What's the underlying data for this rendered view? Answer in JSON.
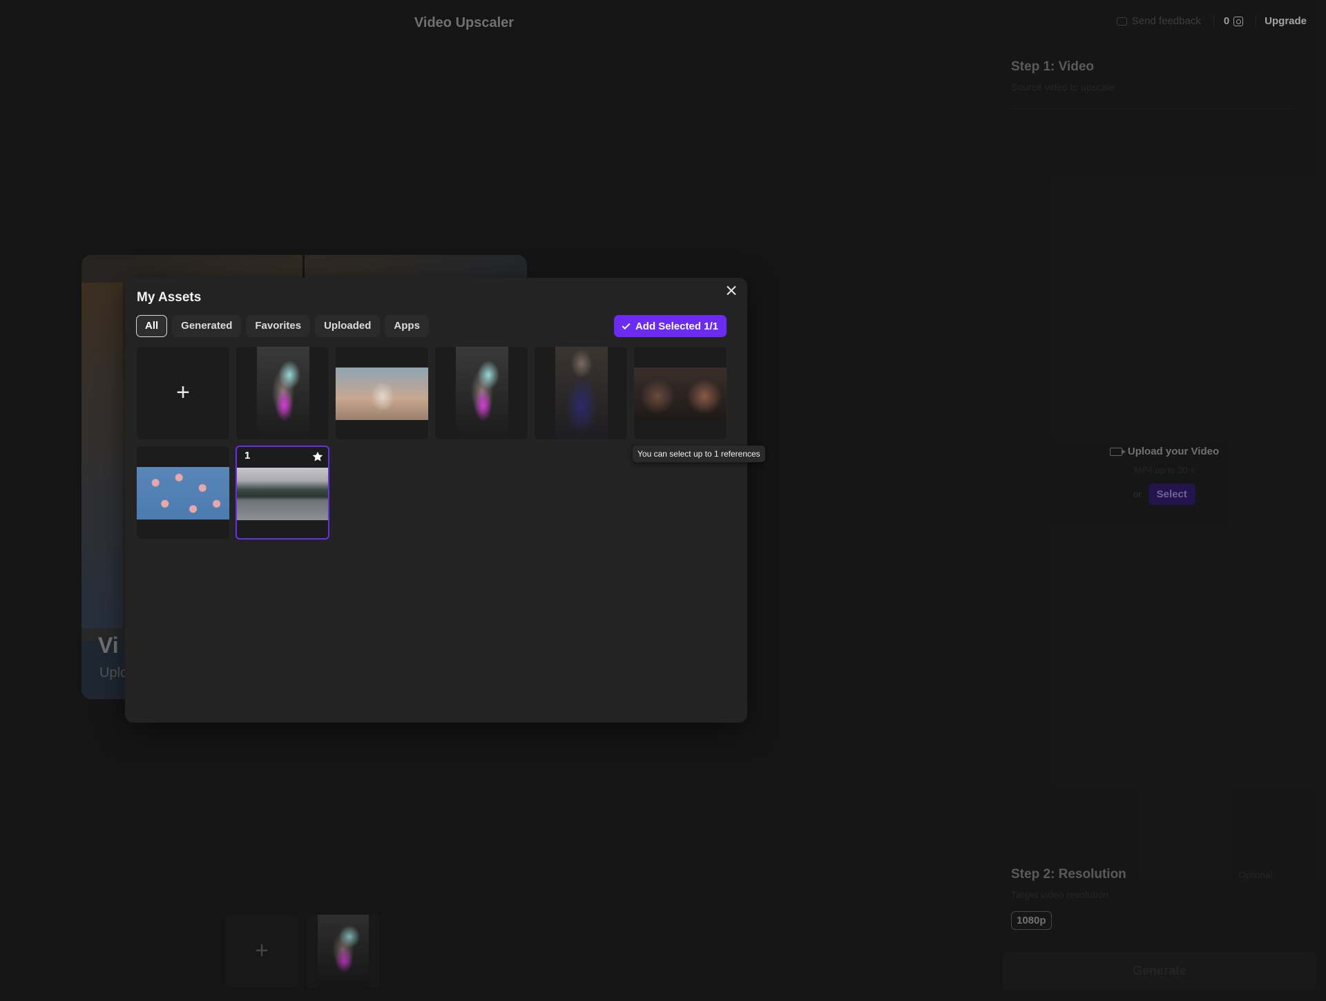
{
  "app": {
    "title": "Video Upscaler"
  },
  "topbar": {
    "feedback_label": "Send feedback",
    "credits": "0",
    "upgrade_label": "Upgrade"
  },
  "step1": {
    "title": "Step 1: Video",
    "subtitle": "Source video to upscale",
    "upload_label": "Upload your Video",
    "upload_hint": "MP4 up to 30 s",
    "or_text": "or",
    "select_label": "Select"
  },
  "step2": {
    "title": "Step 2: Resolution",
    "subtitle": "Target video resolution",
    "optional_label": "Optional",
    "resolution": "1080p"
  },
  "generate_label": "Generate",
  "bg_card": {
    "title": "Vi",
    "subtitle": "Uplc"
  },
  "ref_strip": {
    "add_symbol": "+"
  },
  "modal": {
    "title": "My Assets",
    "tabs": [
      {
        "label": "All",
        "active": true
      },
      {
        "label": "Generated",
        "active": false
      },
      {
        "label": "Favorites",
        "active": false
      },
      {
        "label": "Uploaded",
        "active": false
      },
      {
        "label": "Apps",
        "active": false
      }
    ],
    "add_selected_label": "Add Selected 1/1",
    "add_tile_symbol": "+",
    "tooltip": "You can select up to 1 references",
    "selected_number": "1",
    "assets": [
      {
        "name": "portrait-glow-1",
        "kind": "portrait-glow"
      },
      {
        "name": "sky-woman",
        "kind": "sky-woman"
      },
      {
        "name": "portrait-glow-2",
        "kind": "portrait-glow"
      },
      {
        "name": "necklace-woman",
        "kind": "necklace-woman"
      },
      {
        "name": "faces",
        "kind": "faces"
      },
      {
        "name": "blossom",
        "kind": "blossom"
      },
      {
        "name": "lake",
        "kind": "lake",
        "selected": true,
        "favorite": true
      }
    ]
  },
  "colors": {
    "accent": "#6a2cf2",
    "modal_bg": "#232323",
    "page_bg": "#1a1a1a"
  }
}
